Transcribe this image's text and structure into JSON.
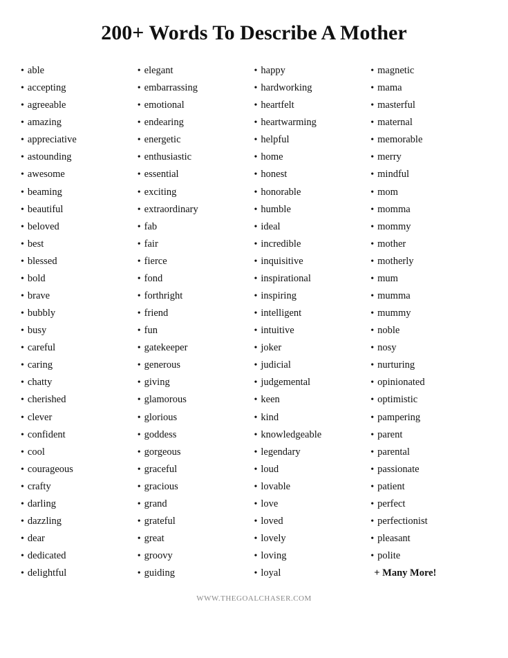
{
  "title": "200+ Words To Describe A Mother",
  "columns": [
    {
      "words": [
        "able",
        "accepting",
        "agreeable",
        "amazing",
        "appreciative",
        "astounding",
        "awesome",
        "beaming",
        "beautiful",
        "beloved",
        "best",
        "blessed",
        "bold",
        "brave",
        "bubbly",
        "busy",
        "careful",
        "caring",
        "chatty",
        "cherished",
        "clever",
        "confident",
        "cool",
        "courageous",
        "crafty",
        "darling",
        "dazzling",
        "dear",
        "dedicated",
        "delightful"
      ]
    },
    {
      "words": [
        "elegant",
        "embarrassing",
        "emotional",
        "endearing",
        "energetic",
        "enthusiastic",
        "essential",
        "exciting",
        "extraordinary",
        "fab",
        "fair",
        "fierce",
        "fond",
        "forthright",
        "friend",
        "fun",
        "gatekeeper",
        "generous",
        "giving",
        "glamorous",
        "glorious",
        "goddess",
        "gorgeous",
        "graceful",
        "gracious",
        "grand",
        "grateful",
        "great",
        "groovy",
        "guiding"
      ]
    },
    {
      "words": [
        "happy",
        "hardworking",
        "heartfelt",
        "heartwarming",
        "helpful",
        "home",
        "honest",
        "honorable",
        "humble",
        " ideal",
        "incredible",
        "inquisitive",
        "inspirational",
        "inspiring",
        "intelligent",
        "intuitive",
        "joker",
        "judicial",
        "judgemental",
        "keen",
        "kind",
        "knowledgeable",
        "legendary",
        "loud",
        "lovable",
        "love",
        "loved",
        "lovely",
        "loving",
        "loyal"
      ]
    },
    {
      "words": [
        "magnetic",
        "mama",
        "masterful",
        "maternal",
        "memorable",
        "merry",
        "mindful",
        "mom",
        "momma",
        "mommy",
        "mother",
        "motherly",
        "mum",
        "mumma",
        "mummy",
        "noble",
        "nosy",
        "nurturing",
        "opinionated",
        "optimistic",
        "pampering",
        "parent",
        "parental",
        "passionate",
        "patient",
        "perfect",
        "perfectionist",
        "pleasant",
        "polite"
      ],
      "extra": "+ Many More!"
    }
  ],
  "footer": "WWW.THEGOALCHASER.COM"
}
